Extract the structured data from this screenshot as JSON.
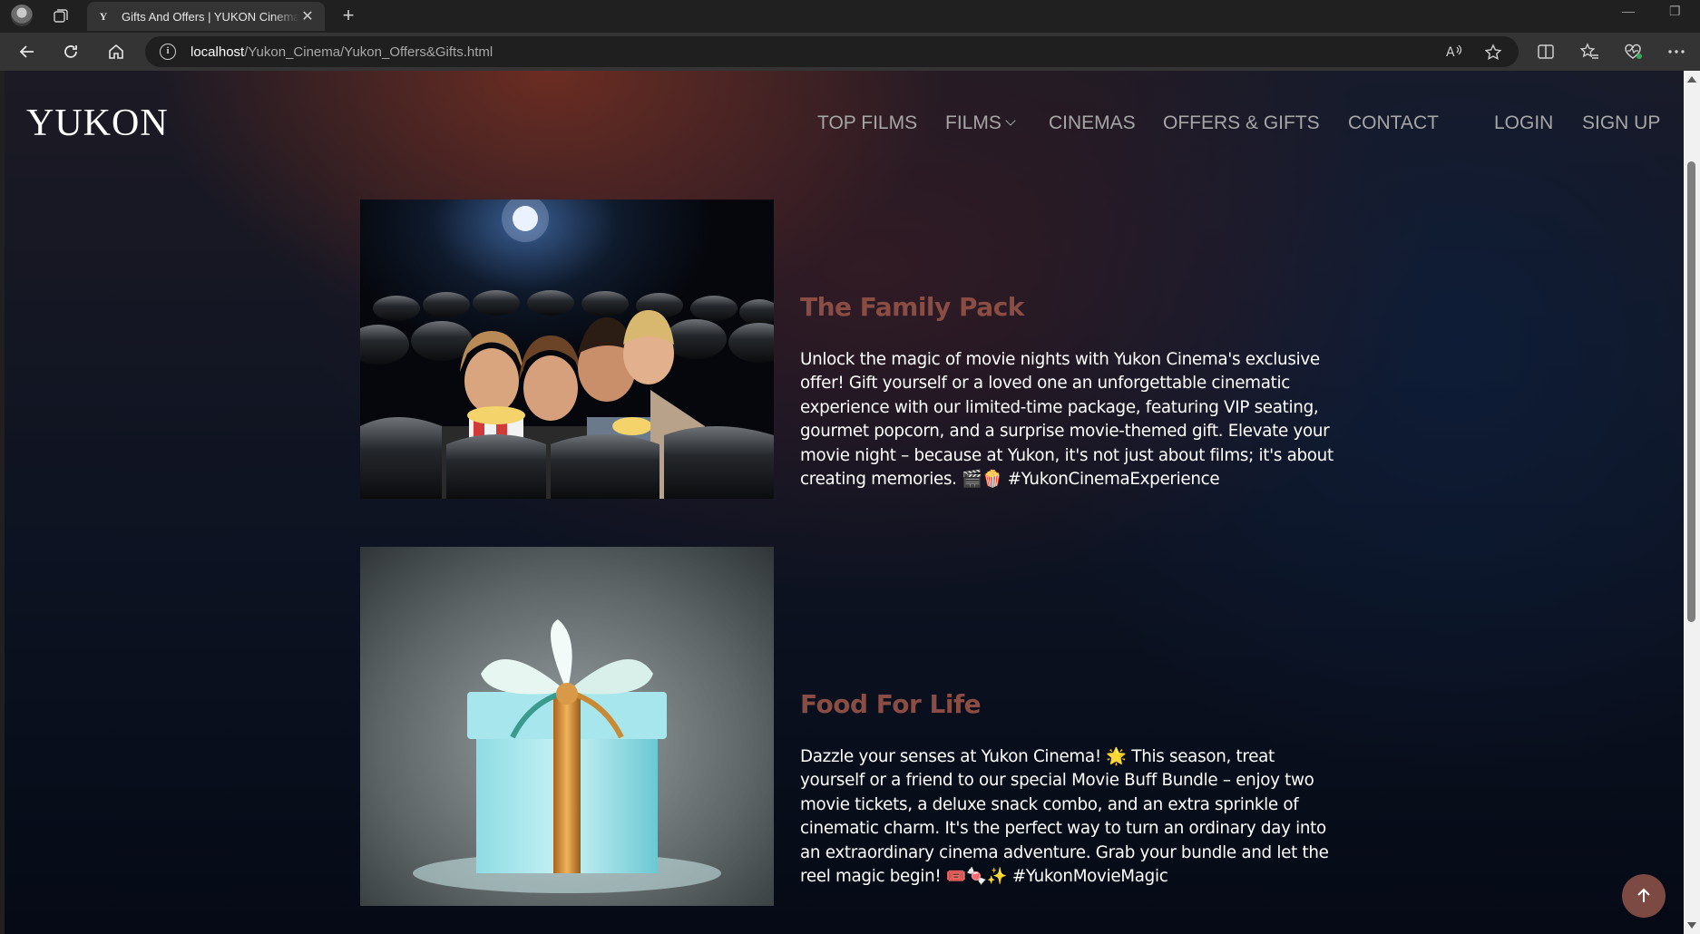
{
  "browser": {
    "tab_title": "Gifts And Offers | YUKON Cinema",
    "tab_favicon": "Y",
    "url_host": "localhost",
    "url_path": "/Yukon_Cinema/Yukon_Offers&Gifts.html"
  },
  "site": {
    "logo": "YUKON",
    "nav": {
      "top_films": "TOP FILMS",
      "films": "FILMS",
      "cinemas": "CINEMAS",
      "offers_gifts": "OFFERS & GIFTS",
      "contact": "CONTACT",
      "login": "LOGIN",
      "signup": "SIGN UP"
    }
  },
  "offers": [
    {
      "title": "The Family Pack",
      "description": "Unlock the magic of movie nights with Yukon Cinema's exclusive offer! Gift yourself or a loved one an unforgettable cinematic experience with our limited-time package, featuring VIP seating, gourmet popcorn, and a surprise movie-themed gift. Elevate your movie night – because at Yukon, it's not just about films; it's about creating memories. 🎬🍿 #YukonCinemaExperience"
    },
    {
      "title": "Food For Life",
      "description": "Dazzle your senses at Yukon Cinema! 🌟 This season, treat yourself or a friend to our special Movie Buff Bundle – enjoy two movie tickets, a deluxe snack combo, and an extra sprinkle of cinematic charm. It's the perfect way to turn an ordinary day into an extraordinary cinema adventure. Grab your bundle and let the reel magic begin! 🎟️🍬✨ #YukonMovieMagic"
    }
  ],
  "colors": {
    "accent": "#8a4d43",
    "nav_text": "#a6a6a6",
    "back_to_top": "#7c4a42"
  },
  "icons": [
    "back-arrow-icon",
    "reload-icon",
    "home-icon",
    "info-icon",
    "read-aloud-icon",
    "favorite-star-icon",
    "split-screen-icon",
    "favorites-icon",
    "browser-essentials-icon",
    "more-icon",
    "arrow-up-icon"
  ]
}
